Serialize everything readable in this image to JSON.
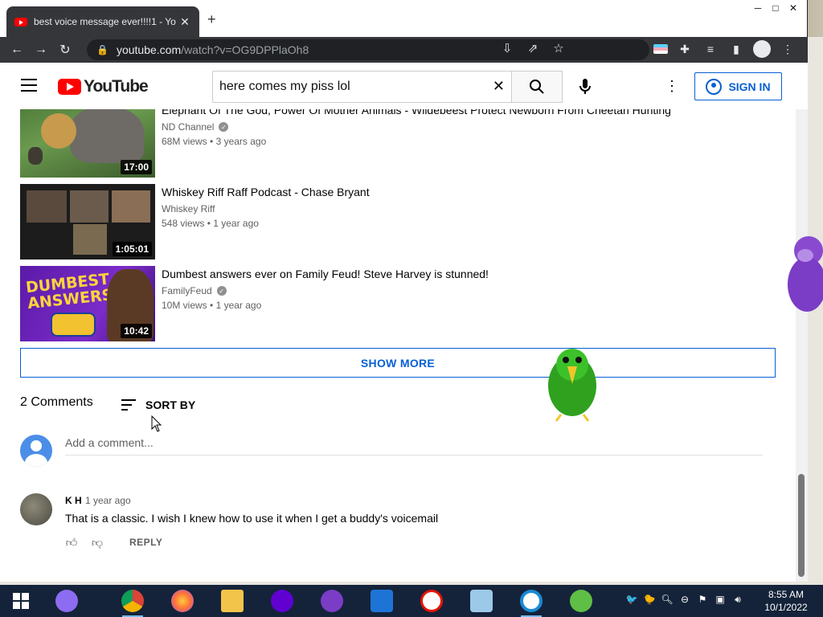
{
  "browser": {
    "tab_title": "best voice message ever!!!!1 - Yo",
    "tab_close": "✕",
    "new_tab": "+",
    "url_host": "youtube.com",
    "url_path": "/watch?v=OG9DPPlaOh8"
  },
  "youtube": {
    "logo_text": "YouTube",
    "search_value": "here comes my piss lol",
    "search_placeholder": "Search",
    "sign_in_label": "SIGN IN"
  },
  "videos": [
    {
      "title": "Elephant Of The God, Power Of Mother Animals - Wildebeest Protect Newborn From Cheetah Hunting",
      "channel": "ND Channel",
      "verified": true,
      "views": "68M views",
      "age": "3 years ago",
      "duration": "17:00"
    },
    {
      "title": "Whiskey Riff Raff Podcast - Chase Bryant",
      "channel": "Whiskey Riff",
      "verified": false,
      "views": "548 views",
      "age": "1 year ago",
      "duration": "1:05:01"
    },
    {
      "title": "Dumbest answers ever on Family Feud! Steve Harvey is stunned!",
      "channel": "FamilyFeud",
      "verified": true,
      "views": "10M views",
      "age": "1 year ago",
      "duration": "10:42",
      "thumb_text": "DUMBEST ANSWERS"
    }
  ],
  "show_more_label": "SHOW MORE",
  "comments": {
    "count_label": "2 Comments",
    "sort_label": "SORT BY",
    "add_placeholder": "Add a comment...",
    "items": [
      {
        "author": "K H",
        "time": "1 year ago",
        "text": "That is a classic. I wish I knew how to use it when I get a buddy's voicemail",
        "reply_label": "REPLY"
      }
    ]
  },
  "taskbar": {
    "time": "8:55 AM",
    "date": "10/1/2022"
  },
  "colors": {
    "youtube_red": "#ff0000",
    "link_blue": "#065fd4",
    "browser_dark": "#35363a",
    "taskbar": "#14233a"
  },
  "icons": [
    "search-icon",
    "mic-icon",
    "more-icon",
    "user-icon",
    "menu-icon",
    "thumbs-up-icon",
    "thumbs-down-icon",
    "sort-icon",
    "lock-icon",
    "star-icon",
    "share-icon",
    "install-icon",
    "puzzle-icon",
    "back-icon",
    "forward-icon",
    "reload-icon"
  ]
}
